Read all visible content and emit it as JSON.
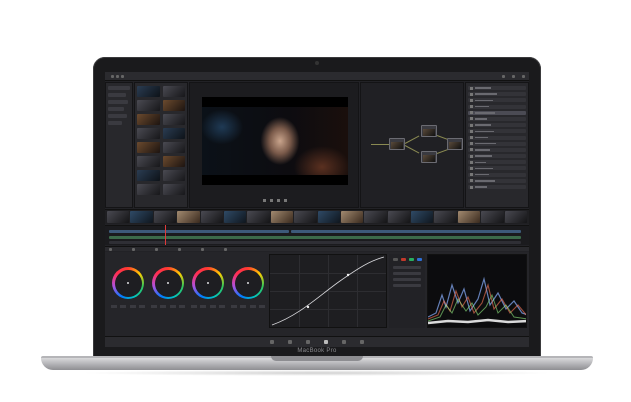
{
  "device": {
    "brand_label": "MacBook Pro"
  },
  "colors": {
    "accent_wire": "#8a8a52",
    "playhead": "#e03a3a",
    "selected_fx": "#4b4b54"
  },
  "icons": [
    "camera-icon",
    "play-icon",
    "stop-icon",
    "rewind-icon",
    "forward-icon",
    "color-wheel-icon",
    "page-nav-icon"
  ]
}
